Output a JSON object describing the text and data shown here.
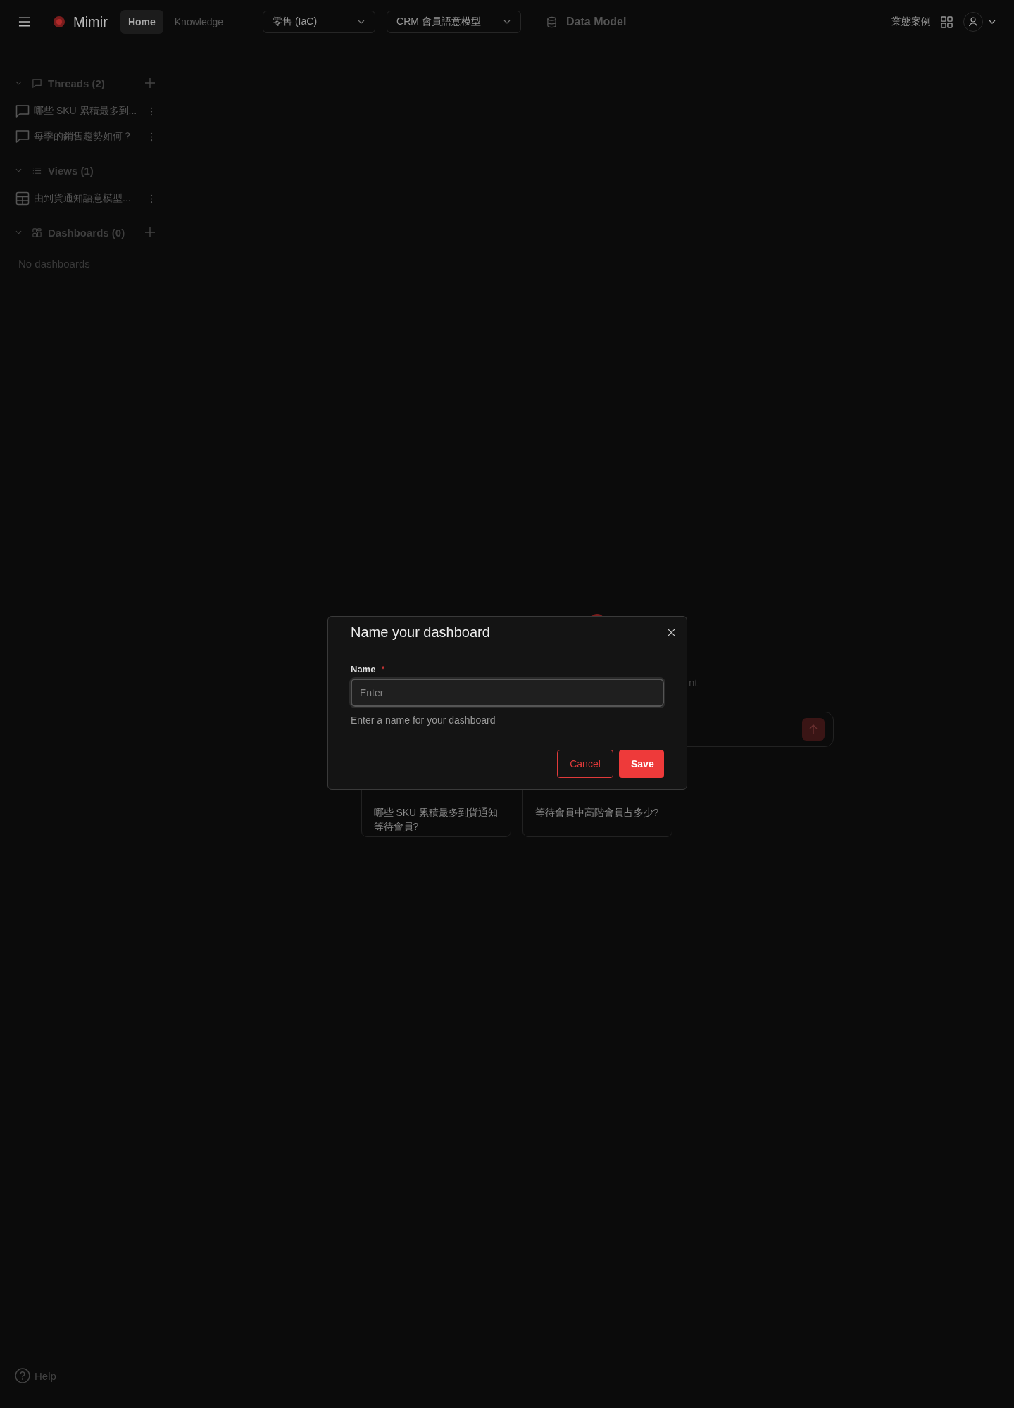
{
  "header": {
    "brand": "Mimir",
    "nav": [
      {
        "label": "Home",
        "selected": true
      },
      {
        "label": "Knowledge",
        "selected": false
      }
    ],
    "dropdowns": [
      {
        "value": "零售 (IaC)"
      },
      {
        "value": "CRM 會員語意模型"
      }
    ],
    "data_model": "Data Model",
    "cases": "業態案例"
  },
  "sidebar": {
    "sections": [
      {
        "kind": "threads",
        "title": "Threads (2)",
        "expanded": true,
        "addable": true,
        "items": [
          {
            "kind": "thread",
            "label": "哪些 SKU 累積最多到..."
          },
          {
            "kind": "thread",
            "label": "每季的銷售趨勢如何？"
          }
        ]
      },
      {
        "kind": "views",
        "title": "Views (1)",
        "expanded": true,
        "addable": false,
        "items": [
          {
            "kind": "view",
            "label": "由到貨通知語意模型..."
          }
        ]
      },
      {
        "kind": "dashboards",
        "title": "Dashboards (0)",
        "expanded": true,
        "addable": true,
        "empty": "No dashboards"
      }
    ],
    "help": "Help"
  },
  "main": {
    "subtitle_fragment": "nt",
    "suggestions": [
      {
        "text": "哪些 SKU 累積最多到貨通知等待會員?"
      },
      {
        "text": "等待會員中高階會員占多少?"
      }
    ]
  },
  "modal": {
    "title": "Name your dashboard",
    "field_label": "Name",
    "required_mark": "*",
    "placeholder": "Enter",
    "help": "Enter a name for your dashboard",
    "buttons": [
      {
        "kind": "secondary",
        "label": "Cancel"
      },
      {
        "kind": "primary",
        "label": "Save"
      }
    ]
  }
}
